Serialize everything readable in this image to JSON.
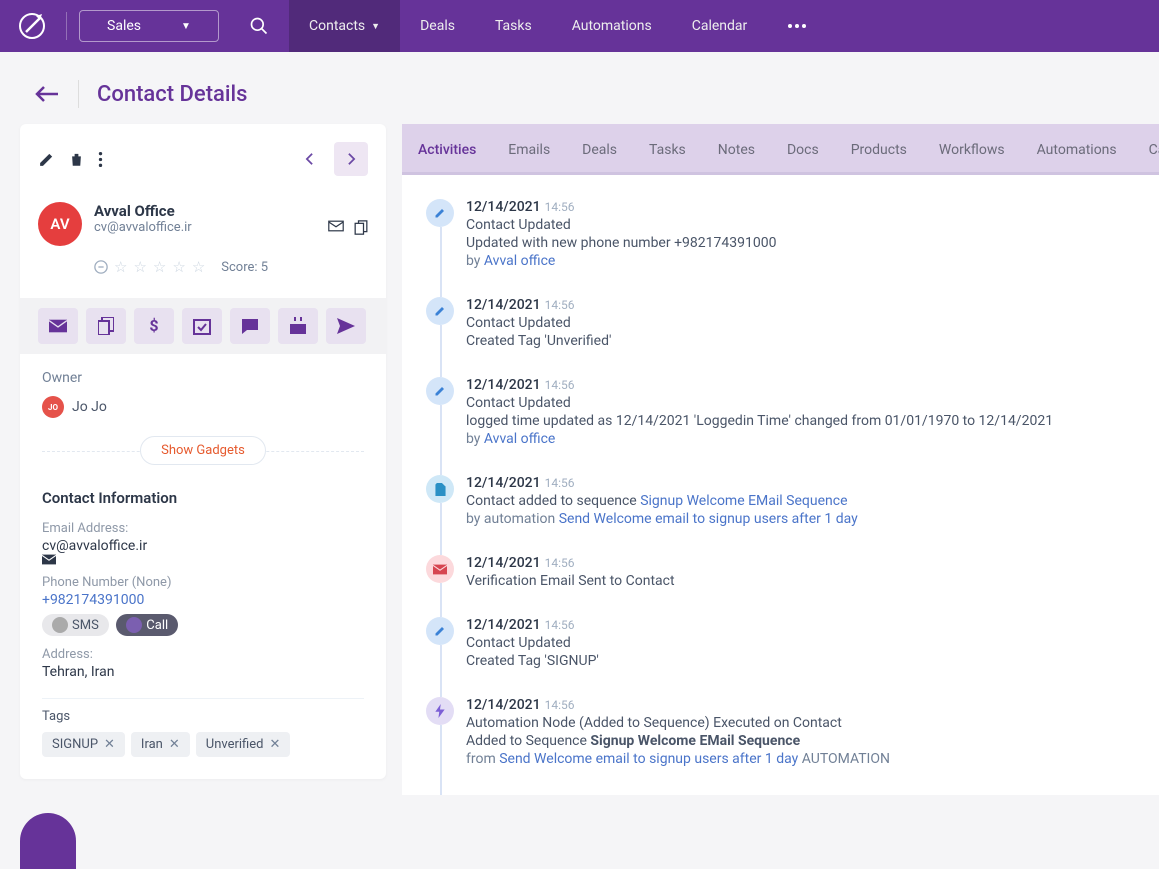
{
  "nav": {
    "module": "Sales",
    "tabs": [
      "Contacts",
      "Deals",
      "Tasks",
      "Automations",
      "Calendar"
    ],
    "activeTab": "Contacts"
  },
  "page": {
    "title": "Contact Details"
  },
  "contact": {
    "initials": "AV",
    "name": "Avval Office",
    "email": "cv@avvaloffice.ir",
    "scoreLabel": "Score: 5"
  },
  "owner": {
    "label": "Owner",
    "initials": "JO",
    "name": "Jo Jo"
  },
  "gadgets": {
    "show": "Show Gadgets"
  },
  "info": {
    "title": "Contact Information",
    "emailLabel": "Email Address:",
    "emailValue": "cv@avvaloffice.ir",
    "phoneLabel": "Phone Number (None)",
    "phoneValue": "+982174391000",
    "sms": "SMS",
    "call": "Call",
    "addressLabel": "Address:",
    "addressValue": "Tehran, Iran"
  },
  "tags": {
    "label": "Tags",
    "items": [
      "SIGNUP",
      "Iran",
      "Unverified"
    ]
  },
  "detailTabs": [
    "Activities",
    "Emails",
    "Deals",
    "Tasks",
    "Notes",
    "Docs",
    "Products",
    "Workflows",
    "Automations",
    "Call"
  ],
  "activeDetailTab": "Activities",
  "timeline": [
    {
      "icon": "edit",
      "date": "12/14/2021",
      "time": "14:56",
      "title": "Contact Updated",
      "desc": "Updated with new phone number +982174391000",
      "byPrefix": "by ",
      "byLink": "Avval office"
    },
    {
      "icon": "edit",
      "date": "12/14/2021",
      "time": "14:56",
      "title": "Contact Updated",
      "desc": "Created Tag 'Unverified'"
    },
    {
      "icon": "edit",
      "date": "12/14/2021",
      "time": "14:56",
      "title": "Contact Updated",
      "desc": "logged time updated as 12/14/2021 'Loggedin Time' changed from 01/01/1970 to 12/14/2021",
      "byPrefix": "by ",
      "byLink": "Avval office"
    },
    {
      "icon": "doc",
      "date": "12/14/2021",
      "time": "14:56",
      "titlePrefix": "Contact added to sequence ",
      "titleLink": "Signup Welcome EMail Sequence",
      "byPrefix": "by automation ",
      "byLink": "Send Welcome email to signup users after 1 day"
    },
    {
      "icon": "mail",
      "date": "12/14/2021",
      "time": "14:56",
      "title": "Verification Email Sent to Contact"
    },
    {
      "icon": "edit",
      "date": "12/14/2021",
      "time": "14:56",
      "title": "Contact Updated",
      "desc": "Created Tag 'SIGNUP'"
    },
    {
      "icon": "bolt",
      "date": "12/14/2021",
      "time": "14:56",
      "title": "Automation Node (Added to Sequence) Executed on Contact",
      "descPrefix": "Added to Sequence ",
      "descBold": "Signup Welcome EMail Sequence",
      "byPrefix": "from ",
      "byLink": "Send Welcome email to signup users after 1 day",
      "bySuffix": " AUTOMATION"
    }
  ]
}
